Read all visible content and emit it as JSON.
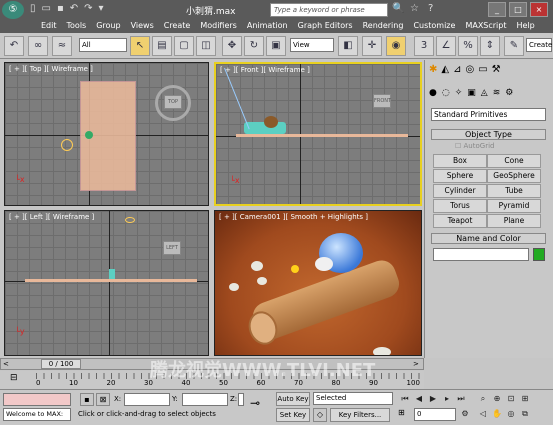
{
  "title_bar": {
    "app_logo": "3ds Max logo",
    "quick_access": [
      "new-icon",
      "open-icon",
      "save-icon",
      "undo-icon",
      "redo-icon",
      "dropdown-icon"
    ],
    "file_title": "小刺猬.max",
    "search_placeholder": "Type a keyword or phrase",
    "window_buttons": [
      "_",
      "□",
      "×"
    ]
  },
  "menu": [
    "Edit",
    "Tools",
    "Group",
    "Views",
    "Create",
    "Modifiers",
    "Animation",
    "Graph Editors",
    "Rendering",
    "Customize",
    "MAXScript",
    "Help"
  ],
  "toolbar": {
    "selection_filter": "All",
    "reference_coord": "View",
    "create_selection_set": "Create"
  },
  "viewports": {
    "top": {
      "label": "[ + ][ Top ][ Wireframe ]",
      "cube": "TOP"
    },
    "front": {
      "label": "[ + ][ Front ][ Wireframe ]",
      "cube": "FRONT"
    },
    "left": {
      "label": "[ + ][ Left ][ Wireframe ]",
      "cube": "LEFT"
    },
    "camera": {
      "label": "[ + ][ Camera001 ][ Smooth + Highlights ]"
    }
  },
  "command_panel": {
    "category_dropdown": "Standard Primitives",
    "object_type_title": "Object Type",
    "autogrid_label": "AutoGrid",
    "primitives": [
      "Box",
      "Cone",
      "Sphere",
      "GeoSphere",
      "Cylinder",
      "Tube",
      "Torus",
      "Pyramid",
      "Teapot",
      "Plane"
    ],
    "name_color_title": "Name and Color",
    "color_swatch": "#22aa22"
  },
  "timeline": {
    "frame_counter": "0 / 100",
    "ticks": [
      "0",
      "10",
      "20",
      "30",
      "40",
      "50",
      "60",
      "70",
      "80",
      "90",
      "100"
    ]
  },
  "status": {
    "maxscript_listener": "Welcome to MAX:",
    "prompt_text": "Click or click-and-drag to select objects",
    "x_label": "X:",
    "y_label": "Y:",
    "z_label": "Z:",
    "auto_key": "Auto Key",
    "set_key": "Set Key",
    "key_mode": "Selected",
    "key_filters": "Key Filters...",
    "current_frame": "0",
    "watermark": "腾龙视觉WWW.TLVI.NET"
  }
}
